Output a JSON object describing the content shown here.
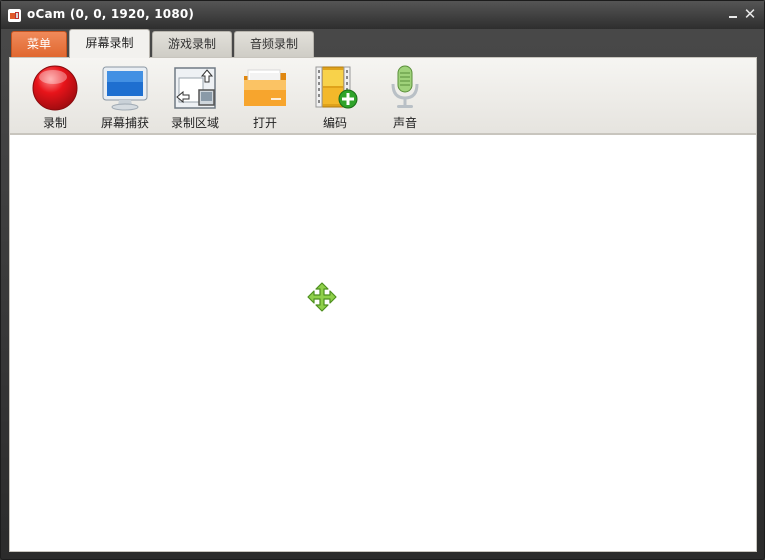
{
  "window": {
    "title": "oCam (0, 0, 1920, 1080)",
    "minimize_icon": "minimize-icon",
    "close_icon": "close-icon",
    "close_glyph": "✕"
  },
  "tabs": [
    {
      "label": "菜单",
      "active": false,
      "accent": "#E8713C"
    },
    {
      "label": "屏幕录制",
      "active": true
    },
    {
      "label": "游戏录制",
      "active": false
    },
    {
      "label": "音频录制",
      "active": false
    }
  ],
  "toolbar": {
    "items": [
      {
        "label": "录制",
        "icon": "record-icon"
      },
      {
        "label": "屏幕捕获",
        "icon": "monitor-icon"
      },
      {
        "label": "录制区域",
        "icon": "resize-area-icon"
      },
      {
        "label": "打开",
        "icon": "folder-icon"
      },
      {
        "label": "编码",
        "icon": "film-add-icon"
      },
      {
        "label": "声音",
        "icon": "microphone-icon"
      }
    ]
  },
  "canvas": {
    "center_icon": "move-icon",
    "accent": "#6DBA2F"
  }
}
